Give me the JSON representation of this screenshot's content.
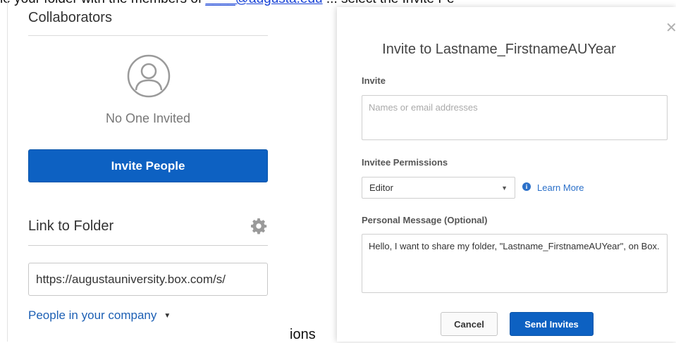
{
  "background": {
    "top_text_left": "le your folder with the members of ",
    "top_link": "____@augusta.edu",
    "top_text_right": " ... select the Invite Pe",
    "bottom_fragment": "ions"
  },
  "left_panel": {
    "collaborators_title": "Collaborators",
    "avatar_icon": "user-circle-icon",
    "empty_state": "No One Invited",
    "invite_button": "Invite People",
    "link_title": "Link to Folder",
    "settings_icon": "gear-icon",
    "link_url": "https://augustauniversity.box.com/s/",
    "access_dropdown": "People in your company"
  },
  "modal": {
    "title": "Invite to Lastname_FirstnameAUYear",
    "close_icon": "close-icon",
    "invite_label": "Invite",
    "invite_placeholder": "Names or email addresses",
    "permissions_label": "Invitee Permissions",
    "permission_value": "Editor",
    "info_icon": "info-icon",
    "learn_more": "Learn More",
    "message_label": "Personal Message (Optional)",
    "message_value": "Hello, I want to share my folder, \"Lastname_FirstnameAUYear\", on Box.",
    "cancel_button": "Cancel",
    "send_button": "Send Invites"
  },
  "colors": {
    "primary_button": "#0d61c2",
    "link": "#1c5fb4"
  }
}
